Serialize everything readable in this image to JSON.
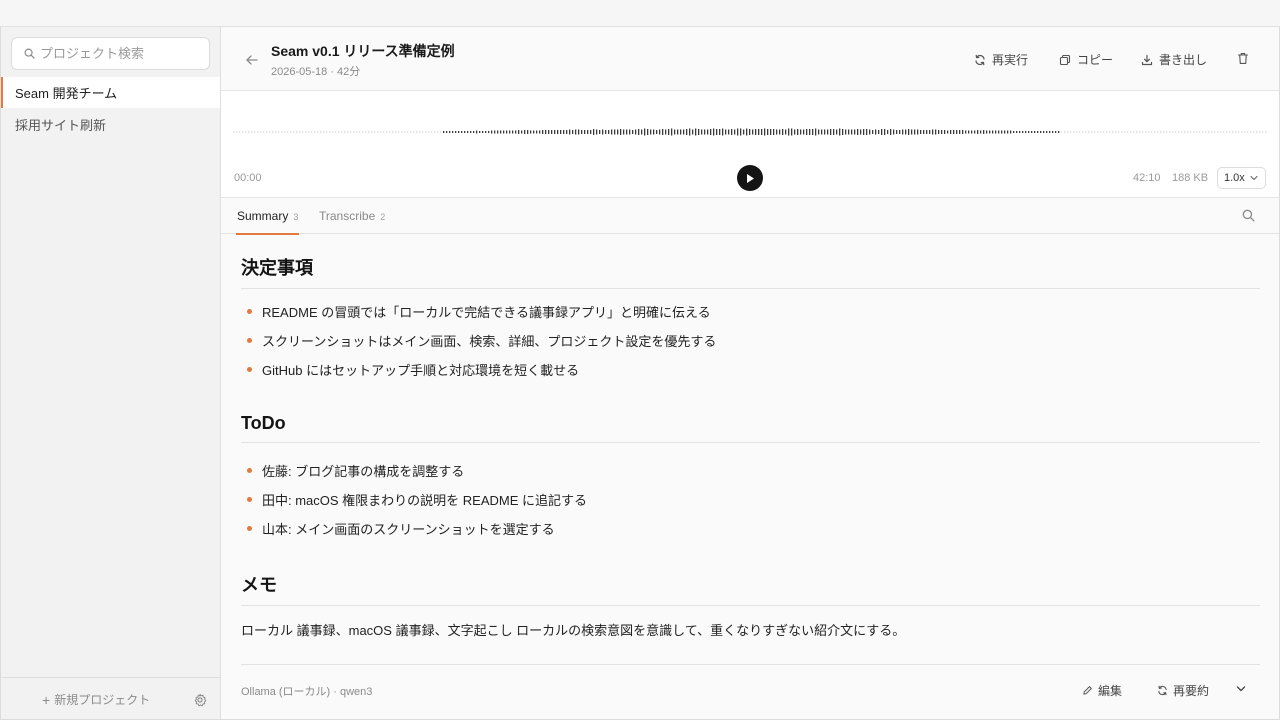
{
  "sidebar": {
    "search_placeholder": "プロジェクト検索",
    "projects": [
      {
        "label": "Seam 開発チーム",
        "active": true
      },
      {
        "label": "採用サイト刷新",
        "active": false
      }
    ],
    "new_project_label": "新規プロジェクト"
  },
  "header": {
    "title": "Seam v0.1 リリース準備定例",
    "meta": "2026-05-18 · 42分",
    "actions": {
      "rerun": "再実行",
      "copy": "コピー",
      "export": "書き出し"
    }
  },
  "player": {
    "current_time": "00:00",
    "duration": "42:10",
    "file_size": "188 KB",
    "speed": "1.0x",
    "progress": 0
  },
  "tabs": [
    {
      "label": "Summary",
      "count": "3",
      "active": true
    },
    {
      "label": "Transcribe",
      "count": "2",
      "active": false
    }
  ],
  "summary": {
    "decisions": {
      "heading": "決定事項",
      "items": [
        "README の冒頭では「ローカルで完結できる議事録アプリ」と明確に伝える",
        "スクリーンショットはメイン画面、検索、詳細、プロジェクト設定を優先する",
        "GitHub にはセットアップ手順と対応環境を短く載せる"
      ]
    },
    "todo": {
      "heading": "ToDo",
      "items": [
        "佐藤: ブログ記事の構成を調整する",
        "田中: macOS 権限まわりの説明を README に追記する",
        "山本: メイン画面のスクリーンショットを選定する"
      ]
    },
    "memo": {
      "heading": "メモ",
      "text": "ローカル 議事録、macOS 議事録、文字起こし ローカルの検索意図を意識して、重くなりすぎない紹介文にする。"
    }
  },
  "footer": {
    "model_info": "Ollama (ローカル) · qwen3",
    "edit_label": "編集",
    "resummarize_label": "再要約"
  },
  "colors": {
    "accent": "#e07a3f",
    "play_button": "#141414"
  }
}
